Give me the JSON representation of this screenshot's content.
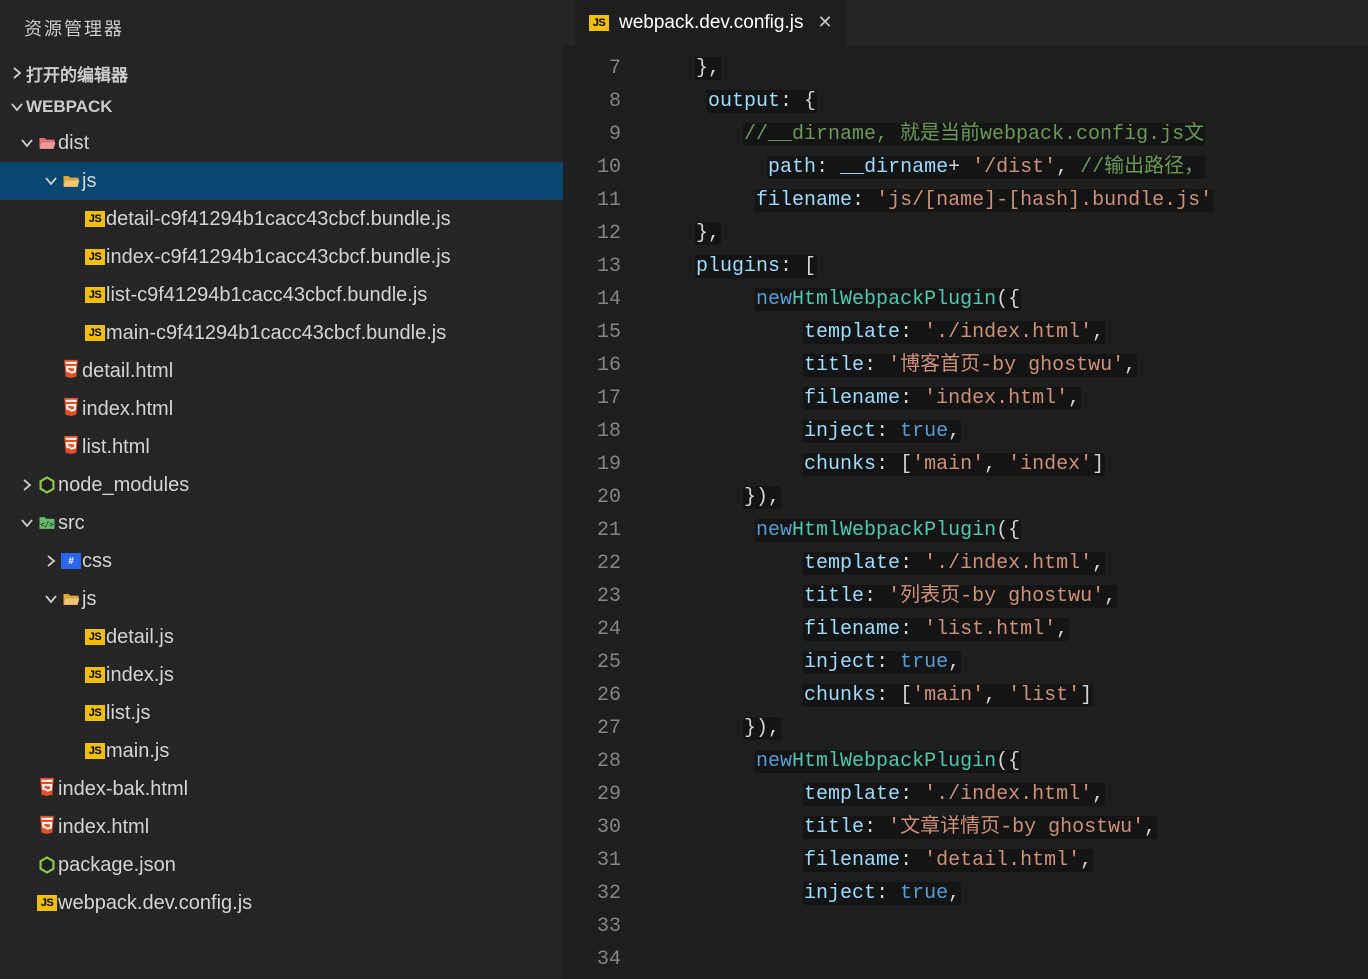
{
  "sidebar": {
    "title": "资源管理器",
    "sections": {
      "open_editors": "打开的编辑器",
      "project": "WEBPACK"
    },
    "tree": [
      {
        "depth": 0,
        "exp": true,
        "icon": "folder-pink-open",
        "label": "dist",
        "name": "folder-dist"
      },
      {
        "depth": 1,
        "exp": true,
        "icon": "folder-yellow-open",
        "label": "js",
        "name": "folder-dist-js",
        "selected": true
      },
      {
        "depth": 2,
        "exp": null,
        "icon": "js",
        "label": "detail-c9f41294b1cacc43cbcf.bundle.js",
        "name": "file-detail-bundle"
      },
      {
        "depth": 2,
        "exp": null,
        "icon": "js",
        "label": "index-c9f41294b1cacc43cbcf.bundle.js",
        "name": "file-index-bundle"
      },
      {
        "depth": 2,
        "exp": null,
        "icon": "js",
        "label": "list-c9f41294b1cacc43cbcf.bundle.js",
        "name": "file-list-bundle"
      },
      {
        "depth": 2,
        "exp": null,
        "icon": "js",
        "label": "main-c9f41294b1cacc43cbcf.bundle.js",
        "name": "file-main-bundle"
      },
      {
        "depth": 1,
        "exp": null,
        "icon": "html",
        "label": "detail.html",
        "name": "file-detail-html"
      },
      {
        "depth": 1,
        "exp": null,
        "icon": "html",
        "label": "index.html",
        "name": "file-dist-index-html"
      },
      {
        "depth": 1,
        "exp": null,
        "icon": "html",
        "label": "list.html",
        "name": "file-list-html"
      },
      {
        "depth": 0,
        "exp": false,
        "icon": "node",
        "label": "node_modules",
        "name": "folder-node-modules"
      },
      {
        "depth": 0,
        "exp": true,
        "icon": "srcfolder",
        "label": "src",
        "name": "folder-src"
      },
      {
        "depth": 1,
        "exp": false,
        "icon": "css",
        "label": "css",
        "name": "folder-css"
      },
      {
        "depth": 1,
        "exp": true,
        "icon": "folder-yellow-open",
        "label": "js",
        "name": "folder-src-js"
      },
      {
        "depth": 2,
        "exp": null,
        "icon": "js",
        "label": "detail.js",
        "name": "file-detail-js"
      },
      {
        "depth": 2,
        "exp": null,
        "icon": "js",
        "label": "index.js",
        "name": "file-index-js"
      },
      {
        "depth": 2,
        "exp": null,
        "icon": "js",
        "label": "list.js",
        "name": "file-list-js"
      },
      {
        "depth": 2,
        "exp": null,
        "icon": "js",
        "label": "main.js",
        "name": "file-main-js"
      },
      {
        "depth": 0,
        "exp": null,
        "icon": "html",
        "label": "index-bak.html",
        "name": "file-index-bak-html"
      },
      {
        "depth": 0,
        "exp": null,
        "icon": "html",
        "label": "index.html",
        "name": "file-root-index-html"
      },
      {
        "depth": 0,
        "exp": null,
        "icon": "node",
        "label": "package.json",
        "name": "file-package-json"
      },
      {
        "depth": 0,
        "exp": null,
        "icon": "js",
        "label": "webpack.dev.config.js",
        "name": "file-webpack-dev-config"
      }
    ]
  },
  "editor": {
    "tab_icon": "js",
    "tab_label": "webpack.dev.config.js",
    "line_start": 7,
    "line_end": 34,
    "code": {
      "l7": [
        [
          "punc",
          "    },"
        ]
      ],
      "l8": [
        [
          "id",
          "    output"
        ],
        [
          "punc",
          " : {"
        ]
      ],
      "l9": [
        [
          "com",
          "        //__dirname, 就是当前webpack.config.js文"
        ]
      ],
      "l10": [
        [
          "id",
          "        path"
        ],
        [
          "punc",
          " : "
        ],
        [
          "glob",
          "__dirname"
        ],
        [
          "punc",
          " + "
        ],
        [
          "str",
          "'/dist'"
        ],
        [
          "punc",
          ", "
        ],
        [
          "com",
          "//输出路径，"
        ]
      ],
      "l11": [
        [
          "id",
          "        filename"
        ],
        [
          "punc",
          " : "
        ],
        [
          "str",
          "'js/[name]-[hash].bundle.js'"
        ]
      ],
      "l12": [
        [
          "punc",
          "    },"
        ]
      ],
      "l13": [
        [
          "id",
          "    plugins"
        ],
        [
          "punc",
          ": ["
        ]
      ],
      "l14": [
        [
          "kw",
          "        new"
        ],
        [
          "punc",
          " "
        ],
        [
          "cls",
          "HtmlWebpackPlugin"
        ],
        [
          "punc",
          "({"
        ]
      ],
      "l15": [
        [
          "id",
          "            template"
        ],
        [
          "punc",
          " : "
        ],
        [
          "str",
          "'./index.html'"
        ],
        [
          "punc",
          ","
        ]
      ],
      "l16": [
        [
          "id",
          "            title"
        ],
        [
          "punc",
          " : "
        ],
        [
          "str",
          "'博客首页-by ghostwu'"
        ],
        [
          "punc",
          ","
        ]
      ],
      "l17": [
        [
          "id",
          "            filename"
        ],
        [
          "punc",
          " : "
        ],
        [
          "str",
          "'index.html'"
        ],
        [
          "punc",
          ","
        ]
      ],
      "l18": [
        [
          "id",
          "            inject"
        ],
        [
          "punc",
          " : "
        ],
        [
          "kw",
          "true"
        ],
        [
          "punc",
          ","
        ]
      ],
      "l19": [
        [
          "id",
          "            chunks"
        ],
        [
          "punc",
          " : ["
        ],
        [
          "str",
          "'main'"
        ],
        [
          "punc",
          ", "
        ],
        [
          "str",
          "'index'"
        ],
        [
          "punc",
          "]"
        ]
      ],
      "l20": [
        [
          "punc",
          "        }),"
        ]
      ],
      "l21": [
        [
          "kw",
          "        new"
        ],
        [
          "punc",
          " "
        ],
        [
          "cls",
          "HtmlWebpackPlugin"
        ],
        [
          "punc",
          "({"
        ]
      ],
      "l22": [
        [
          "id",
          "            template"
        ],
        [
          "punc",
          " : "
        ],
        [
          "str",
          "'./index.html'"
        ],
        [
          "punc",
          ","
        ]
      ],
      "l23": [
        [
          "id",
          "            title"
        ],
        [
          "punc",
          " : "
        ],
        [
          "str",
          "'列表页-by ghostwu'"
        ],
        [
          "punc",
          ","
        ]
      ],
      "l24": [
        [
          "id",
          "            filename"
        ],
        [
          "punc",
          " : "
        ],
        [
          "str",
          "'list.html'"
        ],
        [
          "punc",
          ","
        ]
      ],
      "l25": [
        [
          "id",
          "            inject"
        ],
        [
          "punc",
          " : "
        ],
        [
          "kw",
          "true"
        ],
        [
          "punc",
          ","
        ]
      ],
      "l26": [
        [
          "id",
          "            chunks"
        ],
        [
          "punc",
          " : ["
        ],
        [
          "str",
          "'main'"
        ],
        [
          "punc",
          ", "
        ],
        [
          "str",
          "'list'"
        ],
        [
          "punc",
          "]"
        ]
      ],
      "l27": [
        [
          "punc",
          "        }),"
        ]
      ],
      "l28": [
        [
          "kw",
          "        new"
        ],
        [
          "punc",
          " "
        ],
        [
          "cls",
          "HtmlWebpackPlugin"
        ],
        [
          "punc",
          "({"
        ]
      ],
      "l29": [
        [
          "id",
          "            template"
        ],
        [
          "punc",
          " : "
        ],
        [
          "str",
          "'./index.html'"
        ],
        [
          "punc",
          ","
        ]
      ],
      "l30": [
        [
          "id",
          "            title"
        ],
        [
          "punc",
          " : "
        ],
        [
          "str",
          "'文章详情页-by ghostwu'"
        ],
        [
          "punc",
          ","
        ]
      ],
      "l31": [
        [
          "id",
          "            filename"
        ],
        [
          "punc",
          " : "
        ],
        [
          "str",
          "'detail.html'"
        ],
        [
          "punc",
          ","
        ]
      ],
      "l32": [
        [
          "id",
          "            inject"
        ],
        [
          "punc",
          " : "
        ],
        [
          "kw",
          "true"
        ],
        [
          "punc",
          ","
        ]
      ]
    }
  }
}
